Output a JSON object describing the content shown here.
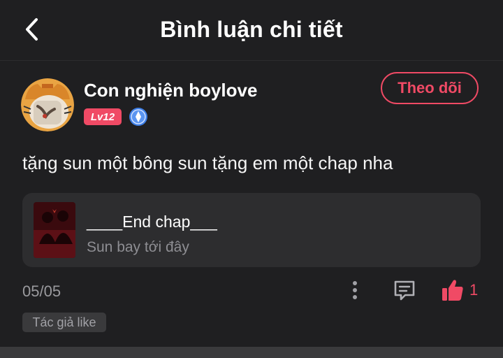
{
  "header": {
    "title": "Bình luận chi tiết"
  },
  "user": {
    "name": "Con nghiện boylove",
    "level": "Lv12",
    "follow_label": "Theo dõi"
  },
  "comment": {
    "text": "tặng sun một bông sun tặng em một chap nha",
    "chapter": {
      "title": "____End chap___",
      "subtitle": "Sun bay tới đây"
    },
    "date": "05/05",
    "likes": "1",
    "author_like_tag": "Tác giả like"
  },
  "colors": {
    "background": "#1f1f21",
    "accent": "#f04a65",
    "card": "#2d2d2f",
    "muted_text": "#9a9a9e"
  },
  "icons": [
    "back-chevron-icon",
    "verified-icon",
    "more-vertical-icon",
    "reply-comment-icon",
    "thumbs-up-icon"
  ]
}
